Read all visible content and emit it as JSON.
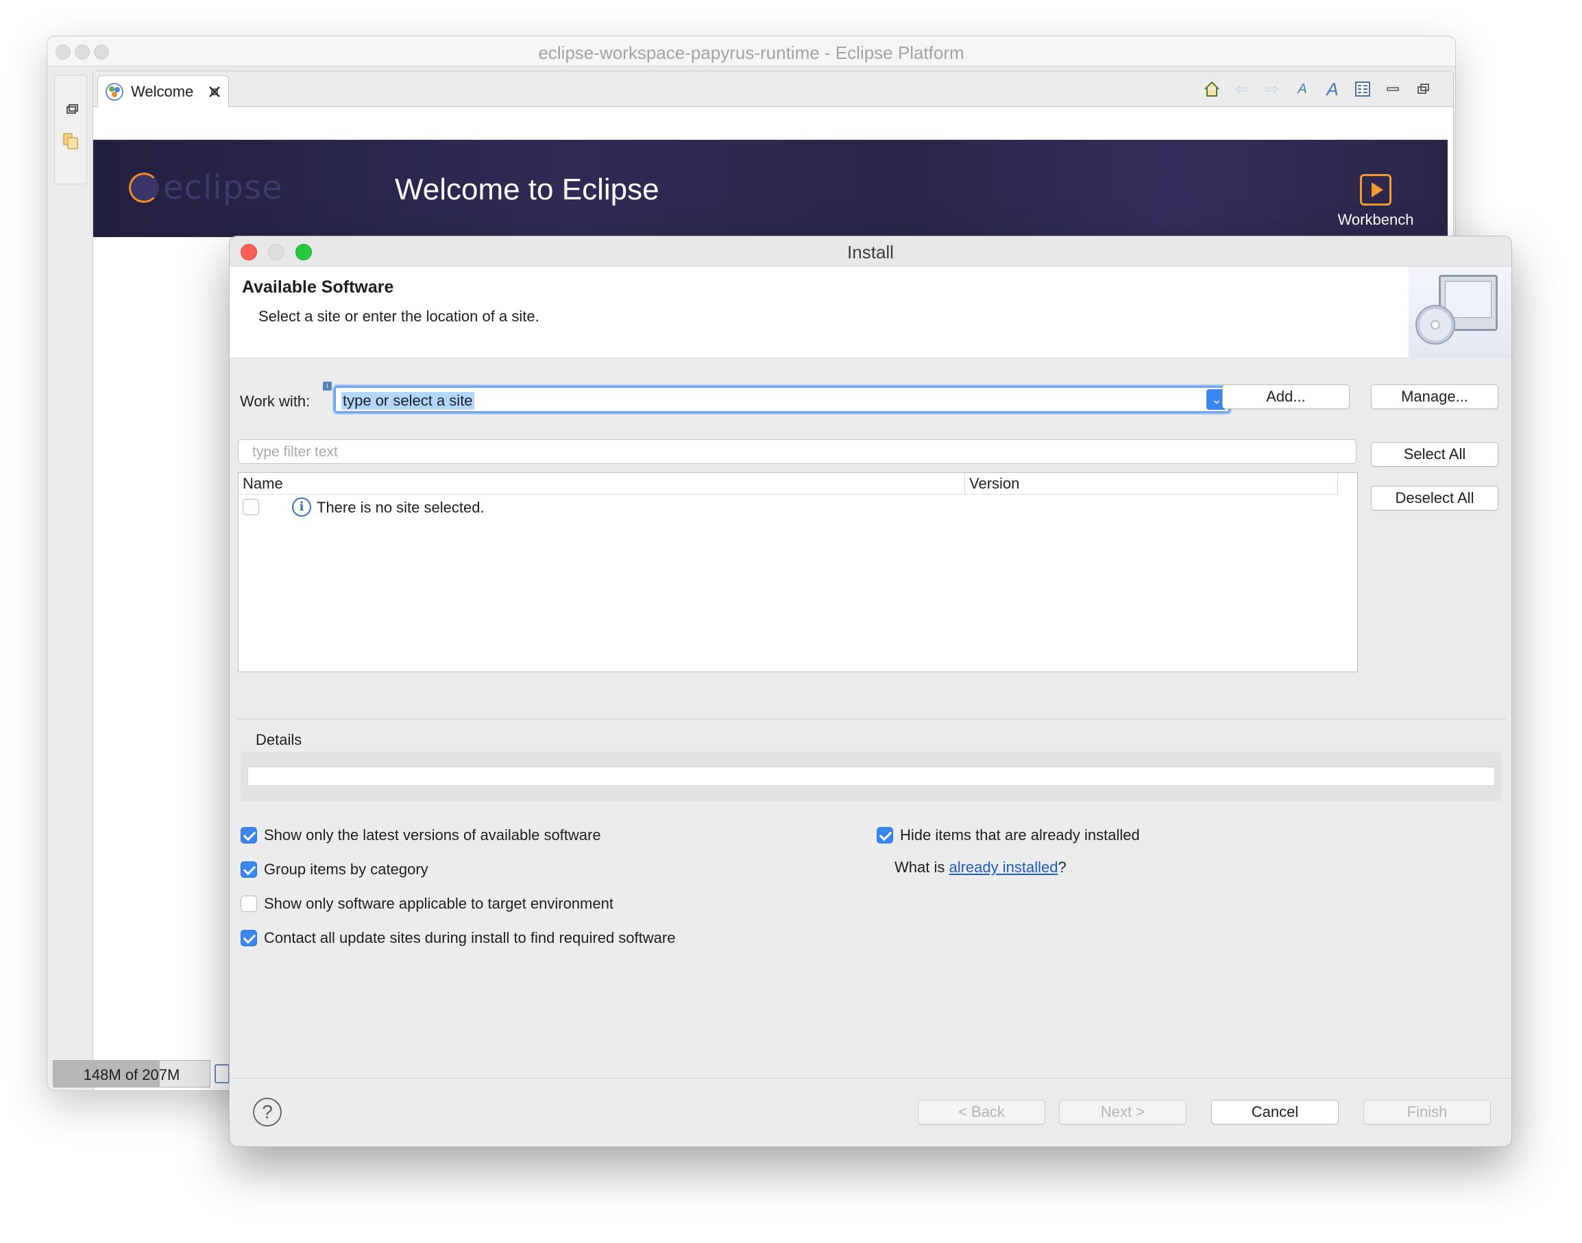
{
  "background_window": {
    "title": "eclipse-workspace-papyrus-runtime - Eclipse Platform",
    "tab_label": "Welcome",
    "banner_title": "Welcome to Eclipse",
    "logo_text": "eclipse",
    "workbench_label": "Workbench",
    "heap_status": "148M of 207M"
  },
  "dialog": {
    "title": "Install",
    "header_title": "Available Software",
    "header_subtitle": "Select a site or enter the location of a site.",
    "work_with_label": "Work with:",
    "work_with_value": "type or select a site",
    "add_button": "Add...",
    "manage_button": "Manage...",
    "filter_placeholder": "type filter text",
    "select_all_button": "Select All",
    "deselect_all_button": "Deselect All",
    "table": {
      "columns": [
        "Name",
        "Version"
      ],
      "rows": [
        {
          "name": "There is no site selected.",
          "version": "",
          "checked": false
        }
      ]
    },
    "details_label": "Details",
    "options_left": [
      {
        "label": "Show only the latest versions of available software",
        "checked": true
      },
      {
        "label": "Group items by category",
        "checked": true
      },
      {
        "label": "Show only software applicable to target environment",
        "checked": false
      },
      {
        "label": "Contact all update sites during install to find required software",
        "checked": true
      }
    ],
    "options_right": [
      {
        "label": "Hide items that are already installed",
        "checked": true
      }
    ],
    "what_is_prefix": "What is ",
    "already_installed_link": "already installed",
    "what_is_suffix": "?",
    "back_button": "< Back",
    "next_button": "Next >",
    "cancel_button": "Cancel",
    "finish_button": "Finish"
  },
  "colors": {
    "accent_blue": "#3a86f0",
    "link_blue": "#1a5bc4",
    "banner_dark": "#2a2649",
    "workbench_orange": "#f29b31"
  }
}
